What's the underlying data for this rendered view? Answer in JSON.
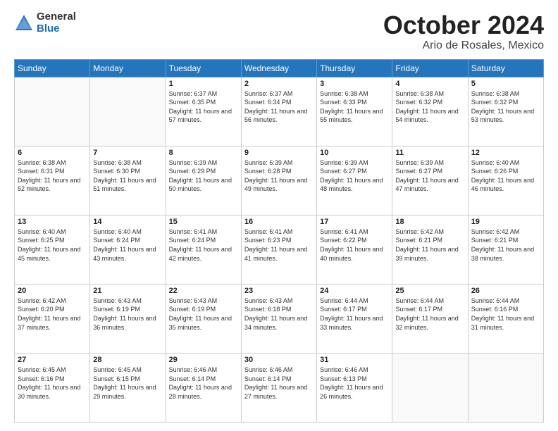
{
  "logo": {
    "general": "General",
    "blue": "Blue"
  },
  "title": "October 2024",
  "subtitle": "Ario de Rosales, Mexico",
  "weekdays": [
    "Sunday",
    "Monday",
    "Tuesday",
    "Wednesday",
    "Thursday",
    "Friday",
    "Saturday"
  ],
  "weeks": [
    [
      {
        "day": "",
        "info": ""
      },
      {
        "day": "",
        "info": ""
      },
      {
        "day": "1",
        "info": "Sunrise: 6:37 AM\nSunset: 6:35 PM\nDaylight: 11 hours and 57 minutes."
      },
      {
        "day": "2",
        "info": "Sunrise: 6:37 AM\nSunset: 6:34 PM\nDaylight: 11 hours and 56 minutes."
      },
      {
        "day": "3",
        "info": "Sunrise: 6:38 AM\nSunset: 6:33 PM\nDaylight: 11 hours and 55 minutes."
      },
      {
        "day": "4",
        "info": "Sunrise: 6:38 AM\nSunset: 6:32 PM\nDaylight: 11 hours and 54 minutes."
      },
      {
        "day": "5",
        "info": "Sunrise: 6:38 AM\nSunset: 6:32 PM\nDaylight: 11 hours and 53 minutes."
      }
    ],
    [
      {
        "day": "6",
        "info": "Sunrise: 6:38 AM\nSunset: 6:31 PM\nDaylight: 11 hours and 52 minutes."
      },
      {
        "day": "7",
        "info": "Sunrise: 6:38 AM\nSunset: 6:30 PM\nDaylight: 11 hours and 51 minutes."
      },
      {
        "day": "8",
        "info": "Sunrise: 6:39 AM\nSunset: 6:29 PM\nDaylight: 11 hours and 50 minutes."
      },
      {
        "day": "9",
        "info": "Sunrise: 6:39 AM\nSunset: 6:28 PM\nDaylight: 11 hours and 49 minutes."
      },
      {
        "day": "10",
        "info": "Sunrise: 6:39 AM\nSunset: 6:27 PM\nDaylight: 11 hours and 48 minutes."
      },
      {
        "day": "11",
        "info": "Sunrise: 6:39 AM\nSunset: 6:27 PM\nDaylight: 11 hours and 47 minutes."
      },
      {
        "day": "12",
        "info": "Sunrise: 6:40 AM\nSunset: 6:26 PM\nDaylight: 11 hours and 46 minutes."
      }
    ],
    [
      {
        "day": "13",
        "info": "Sunrise: 6:40 AM\nSunset: 6:25 PM\nDaylight: 11 hours and 45 minutes."
      },
      {
        "day": "14",
        "info": "Sunrise: 6:40 AM\nSunset: 6:24 PM\nDaylight: 11 hours and 43 minutes."
      },
      {
        "day": "15",
        "info": "Sunrise: 6:41 AM\nSunset: 6:24 PM\nDaylight: 11 hours and 42 minutes."
      },
      {
        "day": "16",
        "info": "Sunrise: 6:41 AM\nSunset: 6:23 PM\nDaylight: 11 hours and 41 minutes."
      },
      {
        "day": "17",
        "info": "Sunrise: 6:41 AM\nSunset: 6:22 PM\nDaylight: 11 hours and 40 minutes."
      },
      {
        "day": "18",
        "info": "Sunrise: 6:42 AM\nSunset: 6:21 PM\nDaylight: 11 hours and 39 minutes."
      },
      {
        "day": "19",
        "info": "Sunrise: 6:42 AM\nSunset: 6:21 PM\nDaylight: 11 hours and 38 minutes."
      }
    ],
    [
      {
        "day": "20",
        "info": "Sunrise: 6:42 AM\nSunset: 6:20 PM\nDaylight: 11 hours and 37 minutes."
      },
      {
        "day": "21",
        "info": "Sunrise: 6:43 AM\nSunset: 6:19 PM\nDaylight: 11 hours and 36 minutes."
      },
      {
        "day": "22",
        "info": "Sunrise: 6:43 AM\nSunset: 6:19 PM\nDaylight: 11 hours and 35 minutes."
      },
      {
        "day": "23",
        "info": "Sunrise: 6:43 AM\nSunset: 6:18 PM\nDaylight: 11 hours and 34 minutes."
      },
      {
        "day": "24",
        "info": "Sunrise: 6:44 AM\nSunset: 6:17 PM\nDaylight: 11 hours and 33 minutes."
      },
      {
        "day": "25",
        "info": "Sunrise: 6:44 AM\nSunset: 6:17 PM\nDaylight: 11 hours and 32 minutes."
      },
      {
        "day": "26",
        "info": "Sunrise: 6:44 AM\nSunset: 6:16 PM\nDaylight: 11 hours and 31 minutes."
      }
    ],
    [
      {
        "day": "27",
        "info": "Sunrise: 6:45 AM\nSunset: 6:16 PM\nDaylight: 11 hours and 30 minutes."
      },
      {
        "day": "28",
        "info": "Sunrise: 6:45 AM\nSunset: 6:15 PM\nDaylight: 11 hours and 29 minutes."
      },
      {
        "day": "29",
        "info": "Sunrise: 6:46 AM\nSunset: 6:14 PM\nDaylight: 11 hours and 28 minutes."
      },
      {
        "day": "30",
        "info": "Sunrise: 6:46 AM\nSunset: 6:14 PM\nDaylight: 11 hours and 27 minutes."
      },
      {
        "day": "31",
        "info": "Sunrise: 6:46 AM\nSunset: 6:13 PM\nDaylight: 11 hours and 26 minutes."
      },
      {
        "day": "",
        "info": ""
      },
      {
        "day": "",
        "info": ""
      }
    ]
  ]
}
